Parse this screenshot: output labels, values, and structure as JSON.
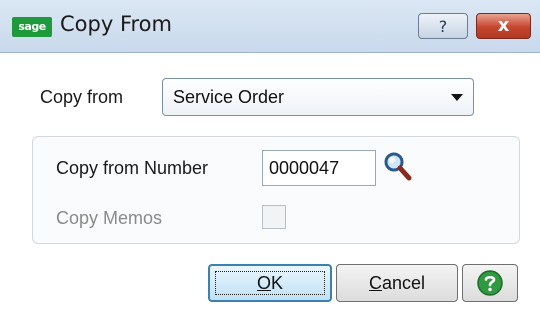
{
  "window": {
    "title": "Copy From",
    "logo_text": "sage",
    "help_glyph": "?",
    "close_glyph": "x"
  },
  "copy_from": {
    "label": "Copy from",
    "selected": "Service Order"
  },
  "group": {
    "number_label": "Copy from Number",
    "number_value": "0000047",
    "memos_label": "Copy Memos",
    "memos_checked": false
  },
  "buttons": {
    "ok_mnemonic": "O",
    "ok_rest": "K",
    "cancel_mnemonic": "C",
    "cancel_rest": "ancel"
  },
  "colors": {
    "title_bar": "#c9d9ec",
    "logo_green": "#1e9a3c",
    "close_red": "#c6452f",
    "help_green": "#2f9a3f",
    "disabled_text": "#8a8a8a"
  },
  "icons": {
    "lookup": "magnifier-icon",
    "help": "question-circle-icon",
    "dropdown": "chevron-down-icon"
  }
}
